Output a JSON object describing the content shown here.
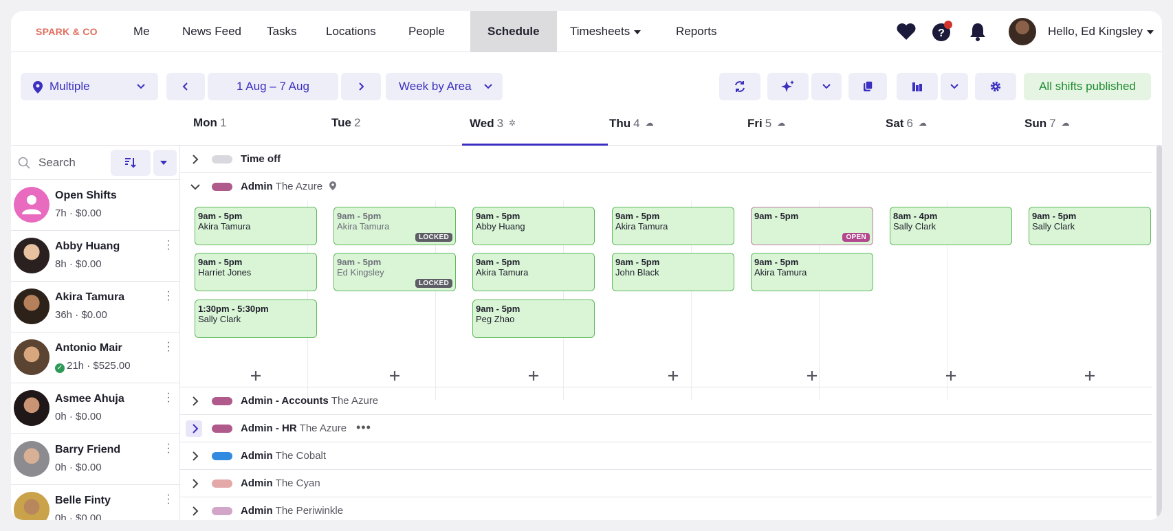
{
  "brand": "SPARK & CO",
  "nav": {
    "items": [
      "Me",
      "News Feed",
      "Tasks",
      "Locations",
      "People",
      "Schedule",
      "Timesheets",
      "Reports"
    ],
    "active": "Schedule",
    "greeting": "Hello, Ed Kingsley"
  },
  "toolbar": {
    "location": "Multiple",
    "date_range": "1 Aug – 7 Aug",
    "view": "Week by Area",
    "status": "All shifts published"
  },
  "days": [
    {
      "name": "Mon",
      "num": "1",
      "weather": ""
    },
    {
      "name": "Tue",
      "num": "2",
      "weather": ""
    },
    {
      "name": "Wed",
      "num": "3",
      "weather": "✲"
    },
    {
      "name": "Thu",
      "num": "4",
      "weather": "☁"
    },
    {
      "name": "Fri",
      "num": "5",
      "weather": "☁"
    },
    {
      "name": "Sat",
      "num": "6",
      "weather": "☁"
    },
    {
      "name": "Sun",
      "num": "7",
      "weather": "☁"
    }
  ],
  "search": {
    "placeholder": "Search"
  },
  "people": [
    {
      "name": "Open Shifts",
      "info": "7h · $0.00"
    },
    {
      "name": "Abby Huang",
      "info": "8h · $0.00"
    },
    {
      "name": "Akira Tamura",
      "info": "36h · $0.00"
    },
    {
      "name": "Antonio Mair",
      "info": "21h · $525.00"
    },
    {
      "name": "Asmee Ahuja",
      "info": "0h · $0.00"
    },
    {
      "name": "Barry Friend",
      "info": "0h · $0.00"
    },
    {
      "name": "Belle Finty",
      "info": "0h · $0.00"
    }
  ],
  "areas": {
    "time_off": "Time off",
    "admin": {
      "name": "Admin",
      "loc": "The Azure"
    },
    "collapsed": [
      {
        "name": "Admin - Accounts",
        "loc": "The Azure",
        "color": "#b05a8c"
      },
      {
        "name": "Admin - HR",
        "loc": "The Azure",
        "color": "#b05a8c"
      },
      {
        "name": "Admin",
        "loc": "The Cobalt",
        "color": "#2f8ae0"
      },
      {
        "name": "Admin",
        "loc": "The Cyan",
        "color": "#e4a8a8"
      },
      {
        "name": "Admin",
        "loc": "The Periwinkle",
        "color": "#d2a6c8"
      }
    ]
  },
  "shifts": {
    "mon": [
      {
        "time": "9am - 5pm",
        "who": "Akira Tamura"
      },
      {
        "time": "9am - 5pm",
        "who": "Harriet Jones"
      },
      {
        "time": "1:30pm - 5:30pm",
        "who": "Sally Clark"
      }
    ],
    "tue": [
      {
        "time": "9am - 5pm",
        "who": "Akira Tamura",
        "badge": "LOCKED"
      },
      {
        "time": "9am - 5pm",
        "who": "Ed Kingsley",
        "badge": "LOCKED"
      }
    ],
    "wed": [
      {
        "time": "9am - 5pm",
        "who": "Abby Huang"
      },
      {
        "time": "9am - 5pm",
        "who": "Akira Tamura"
      },
      {
        "time": "9am - 5pm",
        "who": "Peg Zhao"
      }
    ],
    "thu": [
      {
        "time": "9am - 5pm",
        "who": "Akira Tamura"
      },
      {
        "time": "9am - 5pm",
        "who": "John Black"
      }
    ],
    "fri": [
      {
        "time": "9am - 5pm",
        "who": "",
        "badge": "OPEN"
      },
      {
        "time": "9am - 5pm",
        "who": "Akira Tamura"
      }
    ],
    "sat": [
      {
        "time": "8am - 4pm",
        "who": "Sally Clark"
      }
    ],
    "sun": [
      {
        "time": "9am - 5pm",
        "who": "Sally Clark"
      }
    ]
  }
}
